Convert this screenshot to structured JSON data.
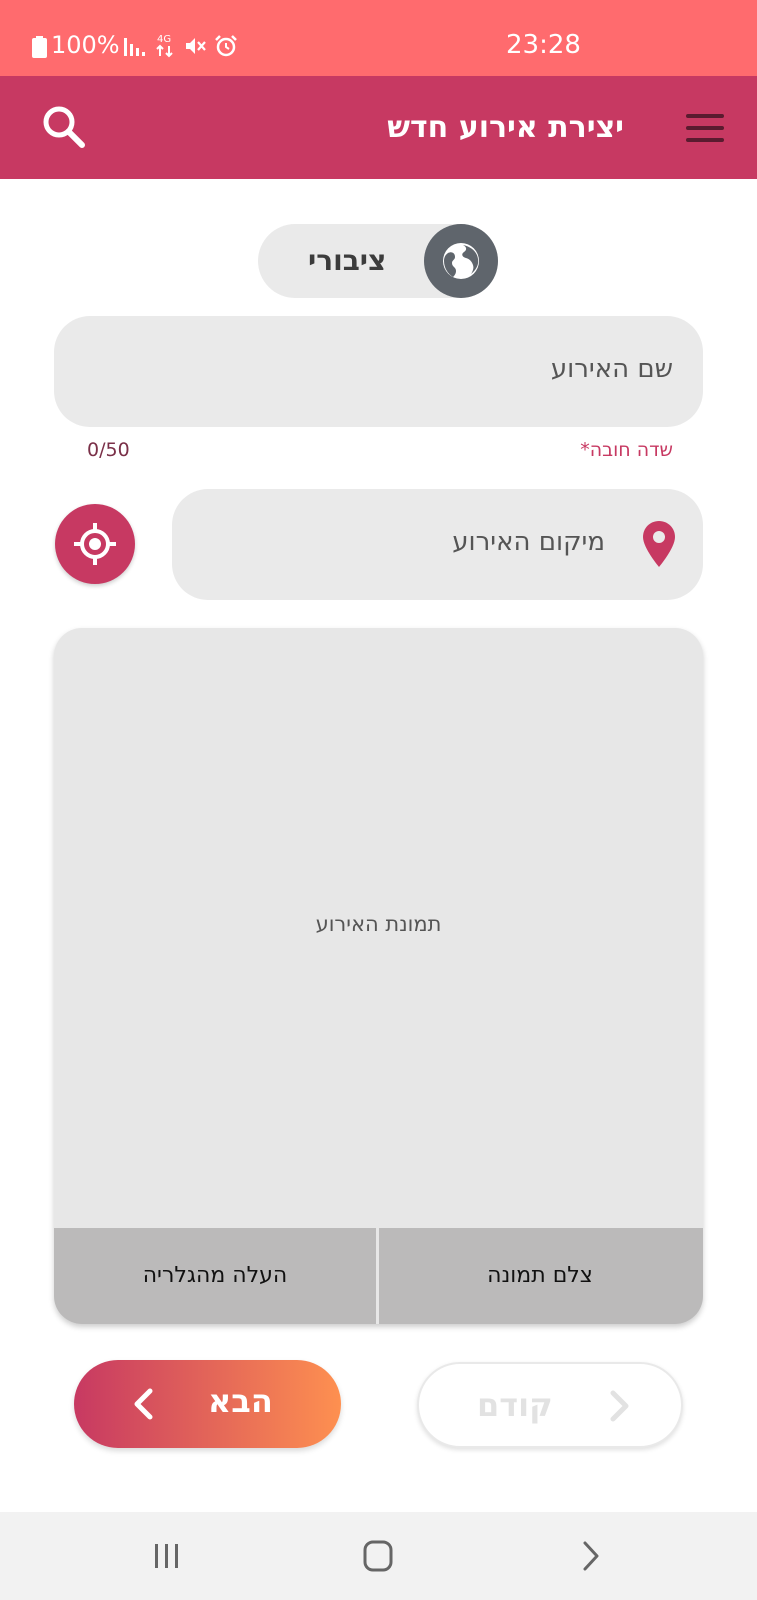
{
  "status_bar": {
    "battery": "100%",
    "time": "23:28",
    "network_type": "4G"
  },
  "app_bar": {
    "title": "יצירת אירוע חדש"
  },
  "privacy_toggle": {
    "label": "ציבורי"
  },
  "event_name": {
    "placeholder": "שם האירוע",
    "required_note": "שדה חובה*",
    "counter": "0/50"
  },
  "event_location": {
    "placeholder": "מיקום האירוע"
  },
  "event_image": {
    "placeholder": "תמונת האירוע",
    "upload_gallery_label": "העלה מהגלריה",
    "take_photo_label": "צלם תמונה"
  },
  "navigation": {
    "next_label": "הבא",
    "prev_label": "קודם"
  },
  "colors": {
    "status_bar": "#ff6b6e",
    "app_bar": "#c73962",
    "accent": "#c73962",
    "gradient_end": "#fe9050",
    "field_bg": "#eaeaea",
    "toggle_knob": "#5f656c"
  }
}
